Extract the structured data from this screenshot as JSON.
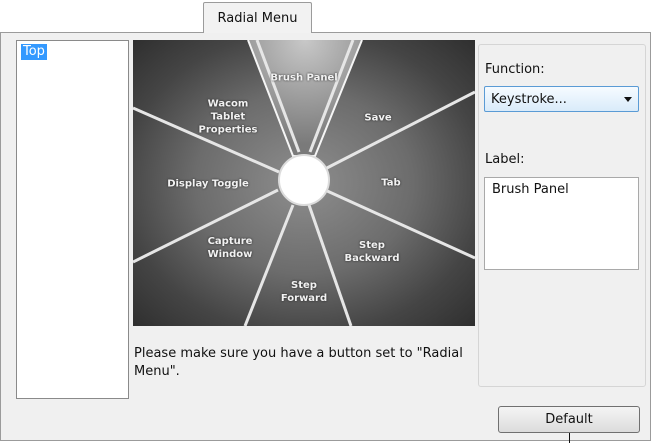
{
  "tab": {
    "label": "Radial Menu"
  },
  "menu_levels": {
    "items": [
      "Top"
    ]
  },
  "radial_menu": {
    "slices": [
      {
        "label": "Brush Panel"
      },
      {
        "label": "Save"
      },
      {
        "label": "Tab"
      },
      {
        "label": "Step\nBackward"
      },
      {
        "label": "Step\nForward"
      },
      {
        "label": "Capture\nWindow"
      },
      {
        "label": "Display Toggle"
      },
      {
        "label": "Wacom\nTablet\nProperties"
      }
    ],
    "selected_slice": "Brush Panel"
  },
  "note": {
    "text": "Please make sure you have a button set to \"Radial Menu\"."
  },
  "function": {
    "label": "Function:",
    "value": "Keystroke..."
  },
  "label_field": {
    "label": "Label:",
    "value": "Brush Panel"
  },
  "buttons": {
    "default": "Default"
  },
  "icons": {
    "dropdown": "chevron-down-icon"
  }
}
